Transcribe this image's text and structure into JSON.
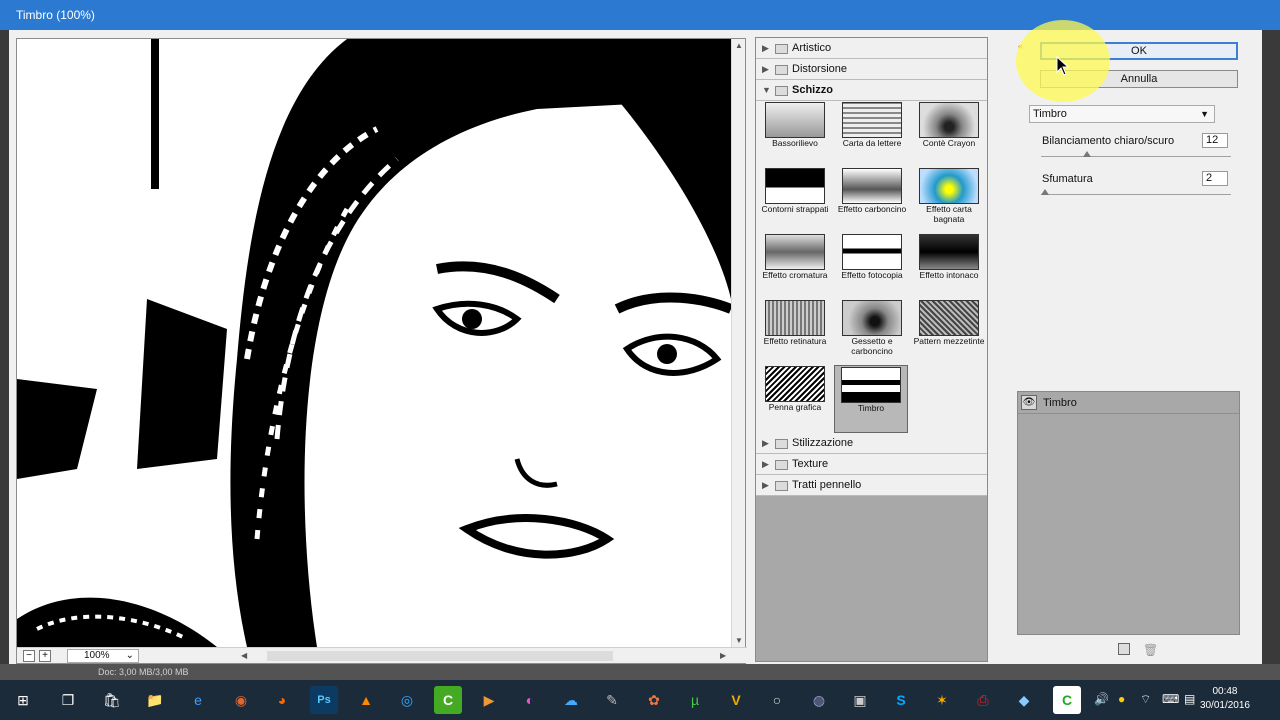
{
  "window": {
    "title": "Timbro (100%)"
  },
  "preview": {
    "zoom": "100%",
    "minus": "−",
    "plus": "+",
    "zoom_caret": "⌄"
  },
  "status": {
    "doc": "Doc: 3,00 MB/3,00 MB"
  },
  "categories": {
    "artistico": "Artistico",
    "distorsione": "Distorsione",
    "schizzo": "Schizzo",
    "stilizzazione": "Stilizzazione",
    "texture": "Texture",
    "tratti": "Tratti pennello"
  },
  "filters": [
    {
      "label": "Bassorilievo"
    },
    {
      "label": "Carta da lettere"
    },
    {
      "label": "Contè Crayon"
    },
    {
      "label": "Contorni strappati"
    },
    {
      "label": "Effetto carboncino"
    },
    {
      "label": "Effetto carta bagnata"
    },
    {
      "label": "Effetto cromatura"
    },
    {
      "label": "Effetto fotocopia"
    },
    {
      "label": "Effetto intonaco"
    },
    {
      "label": "Effetto retinatura"
    },
    {
      "label": "Gessetto e carboncino"
    },
    {
      "label": "Pattern mezzetinte"
    },
    {
      "label": "Penna grafica"
    },
    {
      "label": "Timbro"
    }
  ],
  "buttons": {
    "ok": "OK",
    "cancel": "Annulla"
  },
  "filter_select": {
    "value": "Timbro"
  },
  "params": [
    {
      "label": "Bilanciamento chiaro/scuro",
      "value": "12"
    },
    {
      "label": "Sfumatura",
      "value": "2"
    }
  ],
  "layers": {
    "item": "Timbro"
  },
  "taskbar": {
    "time": "00:48",
    "date": "30/01/2016"
  },
  "colors": {
    "titlebar": "#2b79d0",
    "ok_border": "#3c7fd4",
    "taskbar": "#1c2b3a"
  }
}
